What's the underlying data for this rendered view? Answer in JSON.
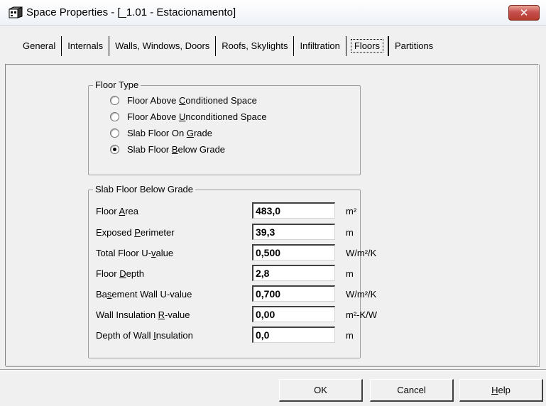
{
  "window": {
    "title": "Space Properties - [_1.01 - Estacionamento]",
    "close_label": "✕"
  },
  "tabs": [
    {
      "label": "General",
      "active": false
    },
    {
      "label": "Internals",
      "active": false
    },
    {
      "label": "Walls, Windows, Doors",
      "active": false
    },
    {
      "label": "Roofs, Skylights",
      "active": false
    },
    {
      "label": "Infiltration",
      "active": false
    },
    {
      "label": "Floors",
      "active": true
    },
    {
      "label": "Partitions",
      "active": false
    }
  ],
  "floor_type": {
    "legend": "Floor Type",
    "options": [
      {
        "pre": "Floor Above ",
        "key": "C",
        "post": "onditioned Space",
        "checked": false
      },
      {
        "pre": "Floor Above ",
        "key": "U",
        "post": "nconditioned Space",
        "checked": false
      },
      {
        "pre": "Slab Floor On ",
        "key": "G",
        "post": "rade",
        "checked": false
      },
      {
        "pre": "Slab Floor ",
        "key": "B",
        "post": "elow Grade",
        "checked": true
      }
    ]
  },
  "slab": {
    "legend": "Slab Floor Below Grade",
    "fields": [
      {
        "pre": "Floor ",
        "key": "A",
        "post": "rea",
        "value": "483,0",
        "unit": "m²"
      },
      {
        "pre": "Exposed ",
        "key": "P",
        "post": "erimeter",
        "value": "39,3",
        "unit": "m"
      },
      {
        "pre": "Total Floor U-",
        "key": "v",
        "post": "alue",
        "value": "0,500",
        "unit": "W/m²/K"
      },
      {
        "pre": "Floor ",
        "key": "D",
        "post": "epth",
        "value": "2,8",
        "unit": "m"
      },
      {
        "pre": "Ba",
        "key": "s",
        "post": "ement Wall U-value",
        "value": "0,700",
        "unit": "W/m²/K"
      },
      {
        "pre": "Wall Insulation ",
        "key": "R",
        "post": "-value",
        "value": "0,00",
        "unit": "m²-K/W"
      },
      {
        "pre": "Depth of Wall ",
        "key": "I",
        "post": "nsulation",
        "value": "0,0",
        "unit": "m"
      }
    ]
  },
  "buttons": {
    "ok": "OK",
    "cancel": "Cancel",
    "help_key": "H",
    "help_rest": "elp"
  }
}
